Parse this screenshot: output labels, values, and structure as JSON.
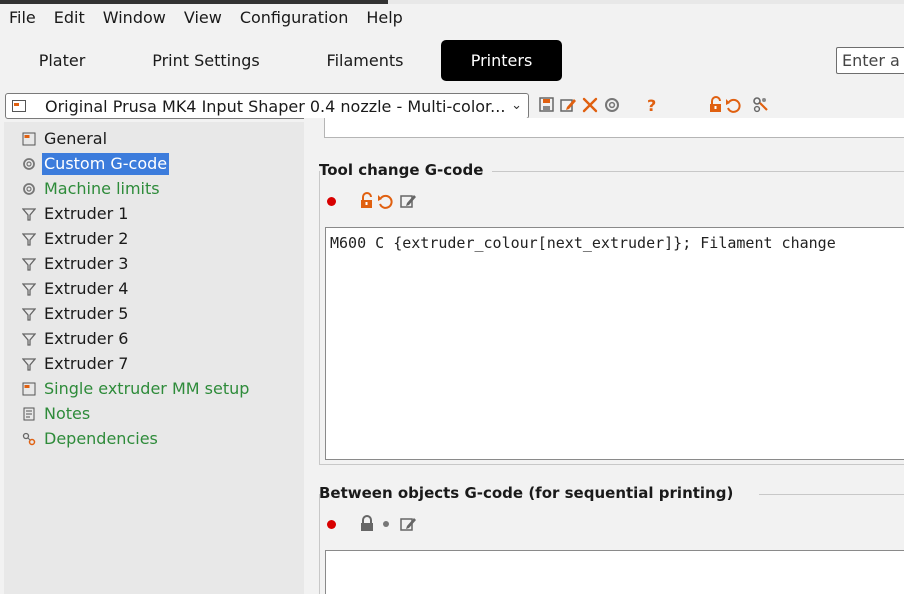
{
  "menubar": {
    "items": [
      "File",
      "Edit",
      "Window",
      "View",
      "Configuration",
      "Help"
    ]
  },
  "tabs": [
    {
      "label": "Plater"
    },
    {
      "label": "Print Settings"
    },
    {
      "label": "Filaments"
    },
    {
      "label": "Printers"
    }
  ],
  "search": {
    "placeholder": "Enter a"
  },
  "preset": {
    "selected": "Original Prusa MK4 Input Shaper 0.4 nozzle - Multi-color..."
  },
  "sidebar": {
    "items": [
      {
        "label": "General"
      },
      {
        "label": "Custom G-code"
      },
      {
        "label": "Machine limits"
      },
      {
        "label": "Extruder 1"
      },
      {
        "label": "Extruder 2"
      },
      {
        "label": "Extruder 3"
      },
      {
        "label": "Extruder 4"
      },
      {
        "label": "Extruder 5"
      },
      {
        "label": "Extruder 6"
      },
      {
        "label": "Extruder 7"
      },
      {
        "label": "Single extruder MM setup"
      },
      {
        "label": "Notes"
      },
      {
        "label": "Dependencies"
      }
    ]
  },
  "sections": {
    "tool_change": {
      "title": "Tool change G-code",
      "code": "M600 C {extruder_colour[next_extruder]}; Filament change"
    },
    "between_objects": {
      "title": "Between objects G-code (for sequential printing)",
      "code": ""
    }
  },
  "colors": {
    "accent": "#000000",
    "selection": "#3c7cdc",
    "modified_green": "#2e8b3a",
    "icon_orange": "#e06010",
    "error_red": "#d80000"
  }
}
